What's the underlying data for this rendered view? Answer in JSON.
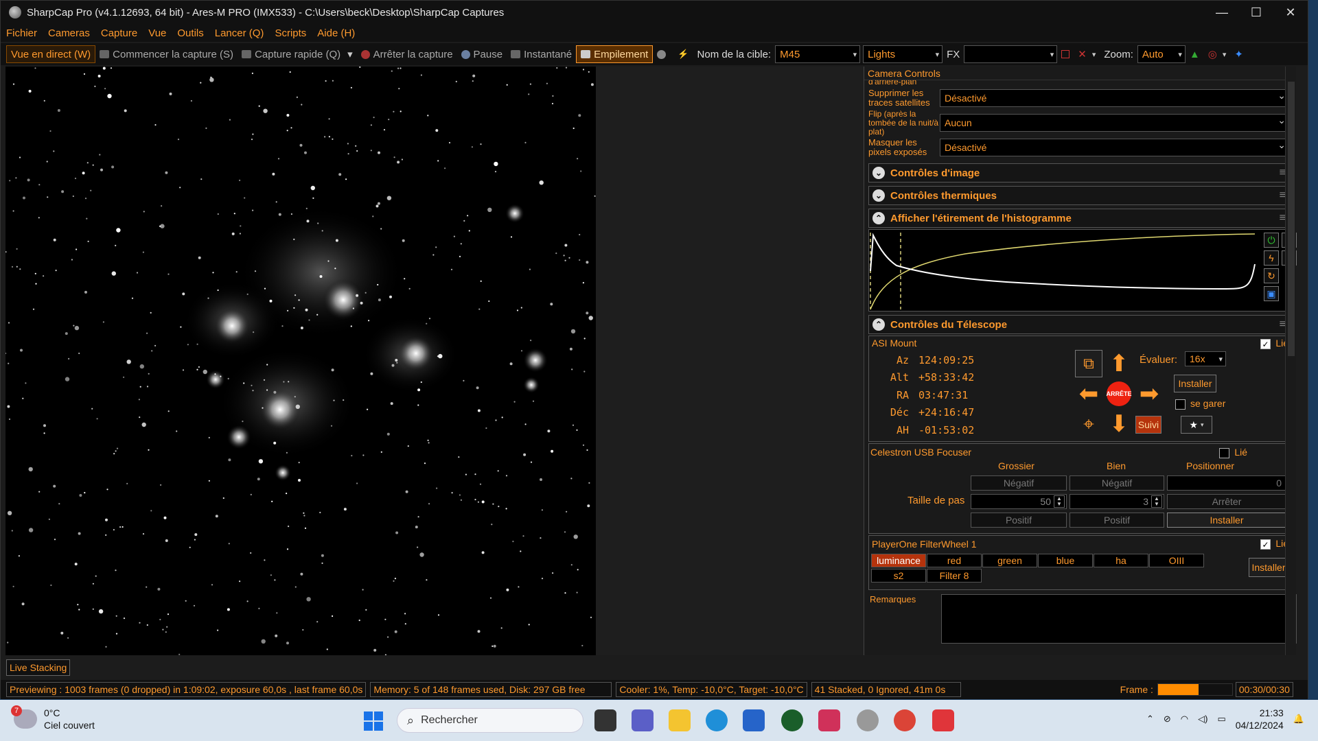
{
  "window": {
    "title": "SharpCap Pro (v4.1.12693, 64 bit) - Ares-M PRO (IMX533) - C:\\Users\\beck\\Desktop\\SharpCap Captures",
    "minimize": "—",
    "maximize": "☐",
    "close": "✕"
  },
  "menu": [
    "Fichier",
    "Cameras",
    "Capture",
    "Vue",
    "Outils",
    "Lancer (Q)",
    "Scripts",
    "Aide (H)"
  ],
  "toolbar": {
    "live_view": "Vue en direct (W)",
    "start_capture": "Commencer la capture (S)",
    "quick_capture": "Capture rapide (Q)",
    "stop_capture": "Arrêter la capture",
    "pause": "Pause",
    "snapshot": "Instantané",
    "stacking": "Empilement",
    "target_label": "Nom de la cible:",
    "target_value": "M45",
    "frame_type": "Lights",
    "fx_label": "FX",
    "fx_value": "",
    "zoom_label": "Zoom:",
    "zoom_value": "Auto"
  },
  "panel": {
    "header": "Camera Controls",
    "partial_label": "d'arrière-plan",
    "rows": [
      {
        "label": "Supprimer les traces satellites",
        "value": "Désactivé"
      },
      {
        "label": "Flip (après la tombée de la nuit/à plat)",
        "value": "Aucun"
      },
      {
        "label": "Masquer les pixels exposés",
        "value": "Désactivé"
      }
    ],
    "sections": {
      "image_controls": "Contrôles d'image",
      "thermal_controls": "Contrôles thermiques",
      "histogram": "Afficher l'étirement de l'histogramme",
      "telescope": "Contrôles du Télescope"
    },
    "mount": {
      "name": "ASI Mount",
      "linked_label": "Lié",
      "linked": true,
      "coords": [
        {
          "k": "Az",
          "v": "124:09:25"
        },
        {
          "k": "Alt",
          "v": "+58:33:42"
        },
        {
          "k": "RA",
          "v": "03:47:31"
        },
        {
          "k": "Déc",
          "v": "+24:16:47"
        },
        {
          "k": "AH",
          "v": "-01:53:02"
        }
      ],
      "stop_label": "ARRÊTE",
      "rate_label": "Évaluer:",
      "rate_value": "16x",
      "install": "Installer",
      "park_label": "se garer",
      "tracking": "Suivi"
    },
    "focuser": {
      "name": "Celestron USB Focuser",
      "linked_label": "Lié",
      "linked": false,
      "col_coarse": "Grossier",
      "col_fine": "Bien",
      "col_position": "Positionner",
      "negative": "Négatif",
      "positive": "Positif",
      "step_label": "Taille de pas",
      "coarse_step": "50",
      "fine_step": "3",
      "position": "0",
      "stop": "Arrêter",
      "install": "Installer"
    },
    "filterwheel": {
      "name": "PlayerOne FilterWheel 1",
      "linked_label": "Lié",
      "linked": true,
      "filters": [
        "luminance",
        "red",
        "green",
        "blue",
        "ha",
        "OIII",
        "s2",
        "Filter 8"
      ],
      "selected": "luminance",
      "install": "Installer"
    },
    "notes_label": "Remarques"
  },
  "live_stacking_tab": "Live Stacking",
  "status": {
    "preview": "Previewing : 1003 frames (0 dropped) in 1:09:02, exposure 60,0s , last frame 60,0s",
    "memory": "Memory: 5 of 148 frames used, Disk: 297 GB free",
    "cooler": "Cooler: 1%, Temp: -10,0°C, Target: -10,0°C",
    "stacked": "41 Stacked, 0 Ignored, 41m 0s",
    "frame_label": "Frame :",
    "frame_progress": 0.55,
    "frame_time": "00:30/00:30"
  },
  "taskbar": {
    "temp": "0°C",
    "weather": "Ciel couvert",
    "weather_badge": "7",
    "search": "Rechercher",
    "time": "21:33",
    "date": "04/12/2024"
  },
  "colors": {
    "accent": "#ff9a2e",
    "selected": "#b5330c",
    "background": "#1a1a1a"
  }
}
